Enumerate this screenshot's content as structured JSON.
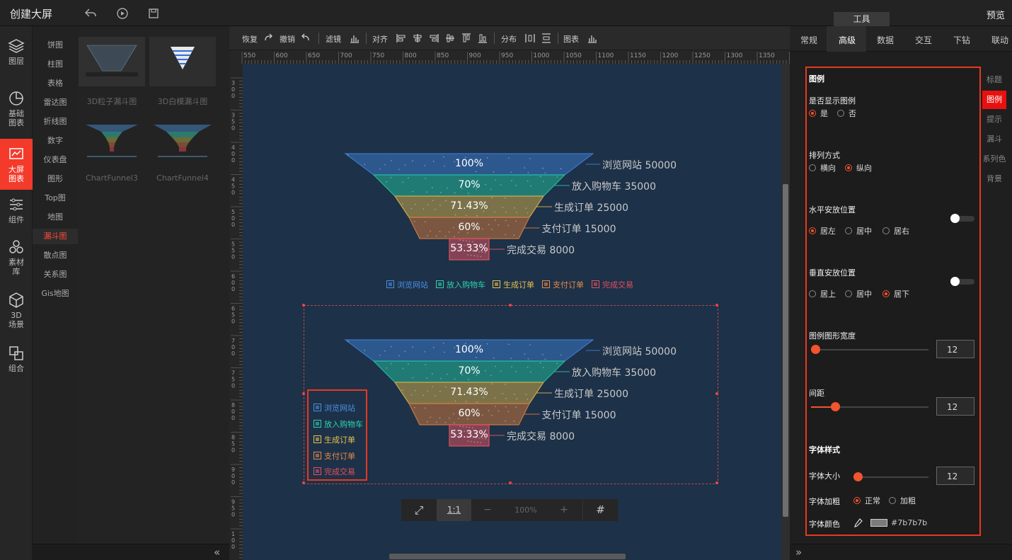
{
  "header": {
    "title": "创建大屏",
    "preview": "预览",
    "tools_tab": "工具"
  },
  "leftnav": [
    {
      "label": "图层",
      "icon": "layers-icon"
    },
    {
      "label": "基础图表",
      "icon": "pie-chart-icon"
    },
    {
      "label": "大屏图表",
      "icon": "screen-chart-icon"
    },
    {
      "label": "组件",
      "icon": "sliders-icon"
    },
    {
      "label": "素材库",
      "icon": "material-icon"
    },
    {
      "label": "3D场景",
      "icon": "cube-icon"
    },
    {
      "label": "组合",
      "icon": "combine-icon"
    }
  ],
  "categories": [
    "饼图",
    "柱图",
    "表格",
    "雷达图",
    "折线图",
    "数字",
    "仪表盘",
    "图形",
    "Top图",
    "地图",
    "漏斗图",
    "散点图",
    "关系图",
    "Gis地图"
  ],
  "active_category": "漏斗图",
  "thumbs": [
    "3D粒子漏斗图",
    "3D白模漏斗图",
    "ChartFunnel3",
    "ChartFunnel4"
  ],
  "toolbar": {
    "redo": "恢复",
    "undo": "撤销",
    "filter": "滤镜",
    "align": "对齐",
    "distribute": "分布",
    "chart": "图表"
  },
  "ruler": {
    "h_ticks": [
      "550",
      "600",
      "650",
      "700",
      "750",
      "800",
      "850",
      "900",
      "950",
      "1000",
      "1050",
      "1100",
      "1150",
      "1200",
      "1250",
      "1300",
      "1350",
      "140"
    ],
    "v_ticks": [
      "300",
      "350",
      "400",
      "450",
      "500",
      "550",
      "600",
      "650",
      "700",
      "750",
      "800",
      "850",
      "900",
      "950",
      "100"
    ]
  },
  "funnel": {
    "series": [
      {
        "name": "浏览网站",
        "value": "50000",
        "pct": "100%",
        "color": "#3a78c9"
      },
      {
        "name": "放入购物车",
        "value": "35000",
        "pct": "70%",
        "color": "#22b89a"
      },
      {
        "name": "生成订单",
        "value": "25000",
        "pct": "71.43%",
        "color": "#c9a84a"
      },
      {
        "name": "支付订单",
        "value": "15000",
        "pct": "60%",
        "color": "#c9773e"
      },
      {
        "name": "完成交易",
        "value": "8000",
        "pct": "53.33%",
        "color": "#d9525e"
      }
    ],
    "legend_colors": [
      "#4b8fe6",
      "#2fd3ae",
      "#e6c24f",
      "#e68a4a",
      "#e6505e"
    ]
  },
  "zoombar": {
    "fit": "⤢",
    "one": "1:1",
    "minus": "−",
    "zoom": "100%",
    "plus": "+",
    "grid": "#"
  },
  "rtabs": [
    "常规",
    "高级",
    "数据",
    "交互",
    "下钻",
    "联动"
  ],
  "active_rtab": "高级",
  "vtabs": [
    "标题",
    "图例",
    "提示",
    "漏斗",
    "系列色",
    "背景"
  ],
  "active_vtab": "图例",
  "form": {
    "section_title": "图例",
    "show_legend": {
      "label": "是否显示图例",
      "yes": "是",
      "no": "否"
    },
    "orient": {
      "label": "排列方式",
      "h": "横向",
      "v": "纵向"
    },
    "hpos": {
      "label": "水平安放位置",
      "left": "居左",
      "center": "居中",
      "right": "居右"
    },
    "vpos": {
      "label": "垂直安放位置",
      "top": "居上",
      "center": "居中",
      "bottom": "居下"
    },
    "width": {
      "label": "图例图形宽度",
      "value": "12"
    },
    "gap": {
      "label": "间距",
      "value": "12"
    },
    "font_title": "字体样式",
    "font_size": {
      "label": "字体大小",
      "value": "12"
    },
    "font_weight": {
      "label": "字体加粗",
      "normal": "正常",
      "bold": "加粗"
    },
    "font_color": {
      "label": "字体颜色",
      "value": "#7b7b7b"
    }
  }
}
